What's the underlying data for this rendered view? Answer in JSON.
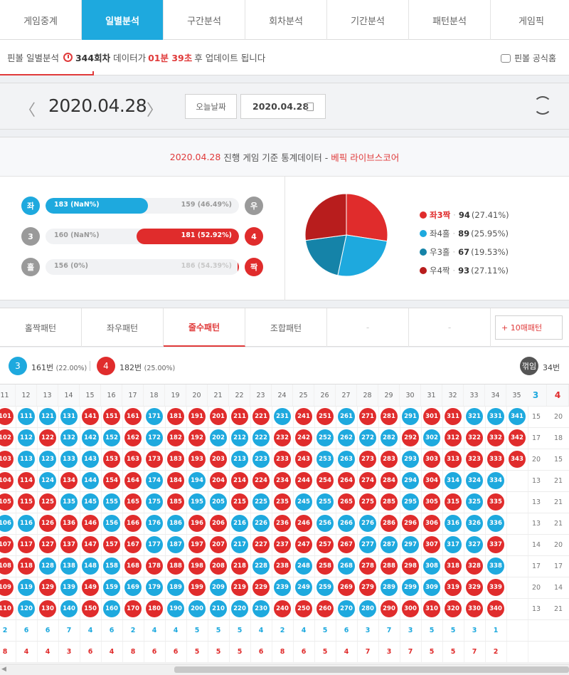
{
  "nav": {
    "tabs": [
      "게임중계",
      "일별분석",
      "구간분석",
      "회차분석",
      "기간분석",
      "패턴분석",
      "게임픽"
    ],
    "active": 1
  },
  "notice": {
    "prefix": "핀볼 일별분석",
    "round": "344회차",
    "mid": "데이터가",
    "time": "01분 39초",
    "suffix": "후 업데이트 됩니다",
    "official": "핀볼 공식홈"
  },
  "datebar": {
    "prev": "〈",
    "next": "〉",
    "date": "2020.04.28",
    "today_label": "오늘날짜",
    "date_input": "2020.04.28"
  },
  "stats": {
    "header_date": "2020.04.28",
    "header_mid": "진행 게임 기준 통계데이터 -",
    "header_source": "베픽 라이브스코어",
    "rows": [
      {
        "left_ball": "좌",
        "right_ball": "우",
        "left_color": "blue",
        "right_color": "gray",
        "left_text": "183 (NaN%)",
        "right_text": "159 (46.49%)",
        "fill_side": "left",
        "fill_ratio": 0.53
      },
      {
        "left_ball": "3",
        "right_ball": "4",
        "left_color": "gray",
        "right_color": "red",
        "left_text": "160 (NaN%)",
        "right_text": "181 (52.92%)",
        "fill_side": "right",
        "fill_ratio": 0.53
      },
      {
        "left_ball": "홀",
        "right_ball": "짝",
        "left_color": "gray",
        "right_color": "red",
        "left_text": "156 (0%)",
        "right_text": "186 (54.39%)",
        "fill_side": "right",
        "fill_ratio": 0.0
      }
    ],
    "legend": [
      {
        "label": "좌3짝",
        "count": "94",
        "pct": "(27.41%)",
        "color": "#e02c2c"
      },
      {
        "label": "좌4홀",
        "count": "89",
        "pct": "(25.95%)",
        "color": "#1ea9de"
      },
      {
        "label": "우3홀",
        "count": "67",
        "pct": "(19.53%)",
        "color": "#1583a8"
      },
      {
        "label": "우4짝",
        "count": "93",
        "pct": "(27.11%)",
        "color": "#b81d1d"
      }
    ]
  },
  "ptabs": {
    "tabs": [
      "홀짝패턴",
      "좌우패턴",
      "줄수패턴",
      "조합패턴",
      "-",
      "-"
    ],
    "active": 2,
    "more": "+ 10매패턴"
  },
  "summary": {
    "a_ball": "3",
    "a_count": "161번",
    "a_pct": "(22.00%)",
    "b_ball": "4",
    "b_count": "182번",
    "b_pct": "(25.00%)",
    "broken_label": "꺾임",
    "broken_count": "34번"
  },
  "grid": {
    "headers": [
      "11",
      "12",
      "13",
      "14",
      "15",
      "16",
      "17",
      "18",
      "19",
      "20",
      "21",
      "22",
      "23",
      "24",
      "25",
      "26",
      "27",
      "28",
      "29",
      "30",
      "31",
      "32",
      "33",
      "34",
      "35"
    ],
    "side_head_a": "3",
    "side_head_b": "4",
    "col_colors": [
      "red",
      "blue",
      "blue",
      "blue",
      "red",
      "red",
      "red",
      "blue",
      "red",
      "red",
      "red",
      "red",
      "red",
      "blue",
      "red",
      "red",
      "blue",
      "red",
      "red",
      "blue",
      "red",
      "red",
      "blue",
      "blue",
      "blue"
    ],
    "col_lengths": [
      10,
      10,
      10,
      10,
      10,
      10,
      10,
      10,
      10,
      10,
      10,
      10,
      10,
      10,
      10,
      10,
      10,
      10,
      10,
      10,
      10,
      10,
      10,
      10,
      3
    ],
    "col_start_num": [
      101,
      111,
      121,
      131,
      141,
      151,
      161,
      171,
      181,
      191,
      201,
      211,
      221,
      231,
      241,
      251,
      261,
      271,
      281,
      291,
      301,
      311,
      321,
      331,
      341
    ],
    "cell_colors": [
      [
        "red",
        "red",
        "red",
        "red",
        "red",
        "blue",
        "red",
        "red",
        "red",
        "red"
      ],
      [
        "blue",
        "blue",
        "blue",
        "red",
        "red",
        "blue",
        "red",
        "red",
        "blue",
        "blue"
      ],
      [
        "blue",
        "red",
        "blue",
        "blue",
        "red",
        "red",
        "red",
        "blue",
        "red",
        "red"
      ],
      [
        "blue",
        "blue",
        "blue",
        "red",
        "blue",
        "red",
        "red",
        "blue",
        "blue",
        "blue"
      ],
      [
        "red",
        "blue",
        "blue",
        "blue",
        "blue",
        "red",
        "red",
        "blue",
        "red",
        "red"
      ],
      [
        "red",
        "blue",
        "red",
        "red",
        "blue",
        "blue",
        "red",
        "blue",
        "blue",
        "blue"
      ],
      [
        "red",
        "red",
        "red",
        "red",
        "red",
        "red",
        "red",
        "red",
        "blue",
        "red"
      ],
      [
        "blue",
        "blue",
        "red",
        "blue",
        "blue",
        "blue",
        "blue",
        "red",
        "blue",
        "red"
      ],
      [
        "red",
        "red",
        "red",
        "red",
        "red",
        "blue",
        "blue",
        "red",
        "blue",
        "blue"
      ],
      [
        "red",
        "red",
        "red",
        "blue",
        "blue",
        "red",
        "red",
        "red",
        "red",
        "blue"
      ],
      [
        "red",
        "blue",
        "red",
        "red",
        "blue",
        "red",
        "red",
        "red",
        "blue",
        "blue"
      ],
      [
        "red",
        "blue",
        "blue",
        "red",
        "red",
        "blue",
        "blue",
        "red",
        "red",
        "blue"
      ],
      [
        "red",
        "blue",
        "blue",
        "red",
        "blue",
        "blue",
        "red",
        "blue",
        "red",
        "blue"
      ],
      [
        "blue",
        "red",
        "red",
        "red",
        "red",
        "red",
        "red",
        "red",
        "blue",
        "red"
      ],
      [
        "red",
        "red",
        "red",
        "red",
        "blue",
        "red",
        "red",
        "blue",
        "blue",
        "red"
      ],
      [
        "red",
        "blue",
        "blue",
        "red",
        "blue",
        "blue",
        "red",
        "red",
        "blue",
        "red"
      ],
      [
        "blue",
        "blue",
        "blue",
        "red",
        "red",
        "blue",
        "red",
        "blue",
        "red",
        "blue"
      ],
      [
        "red",
        "blue",
        "red",
        "red",
        "red",
        "blue",
        "blue",
        "red",
        "red",
        "blue"
      ],
      [
        "red",
        "blue",
        "red",
        "red",
        "red",
        "red",
        "blue",
        "red",
        "blue",
        "red"
      ],
      [
        "blue",
        "red",
        "blue",
        "blue",
        "blue",
        "red",
        "blue",
        "red",
        "blue",
        "red"
      ],
      [
        "red",
        "blue",
        "red",
        "red",
        "red",
        "red",
        "red",
        "blue",
        "blue",
        "red"
      ],
      [
        "red",
        "red",
        "red",
        "blue",
        "red",
        "blue",
        "blue",
        "red",
        "red",
        "red"
      ],
      [
        "blue",
        "red",
        "red",
        "blue",
        "blue",
        "blue",
        "blue",
        "red",
        "red",
        "red"
      ],
      [
        "blue",
        "red",
        "red",
        "blue",
        "red",
        "blue",
        "red",
        "blue",
        "red",
        "red"
      ],
      [
        "blue",
        "red",
        "red"
      ]
    ],
    "side_values": [
      [
        "15",
        "20"
      ],
      [
        "17",
        "18"
      ],
      [
        "20",
        "15"
      ],
      [
        "13",
        "21"
      ],
      [
        "13",
        "21"
      ],
      [
        "13",
        "21"
      ],
      [
        "14",
        "20"
      ],
      [
        "17",
        "17"
      ],
      [
        "20",
        "14"
      ],
      [
        "13",
        "21"
      ]
    ],
    "foot_blue": [
      "2",
      "6",
      "6",
      "7",
      "4",
      "6",
      "2",
      "4",
      "4",
      "5",
      "5",
      "5",
      "4",
      "2",
      "4",
      "5",
      "6",
      "3",
      "7",
      "3",
      "5",
      "5",
      "3",
      "1"
    ],
    "foot_red": [
      "8",
      "4",
      "4",
      "3",
      "6",
      "4",
      "8",
      "6",
      "6",
      "5",
      "5",
      "5",
      "6",
      "8",
      "6",
      "5",
      "4",
      "7",
      "3",
      "7",
      "5",
      "5",
      "7",
      "2"
    ]
  }
}
